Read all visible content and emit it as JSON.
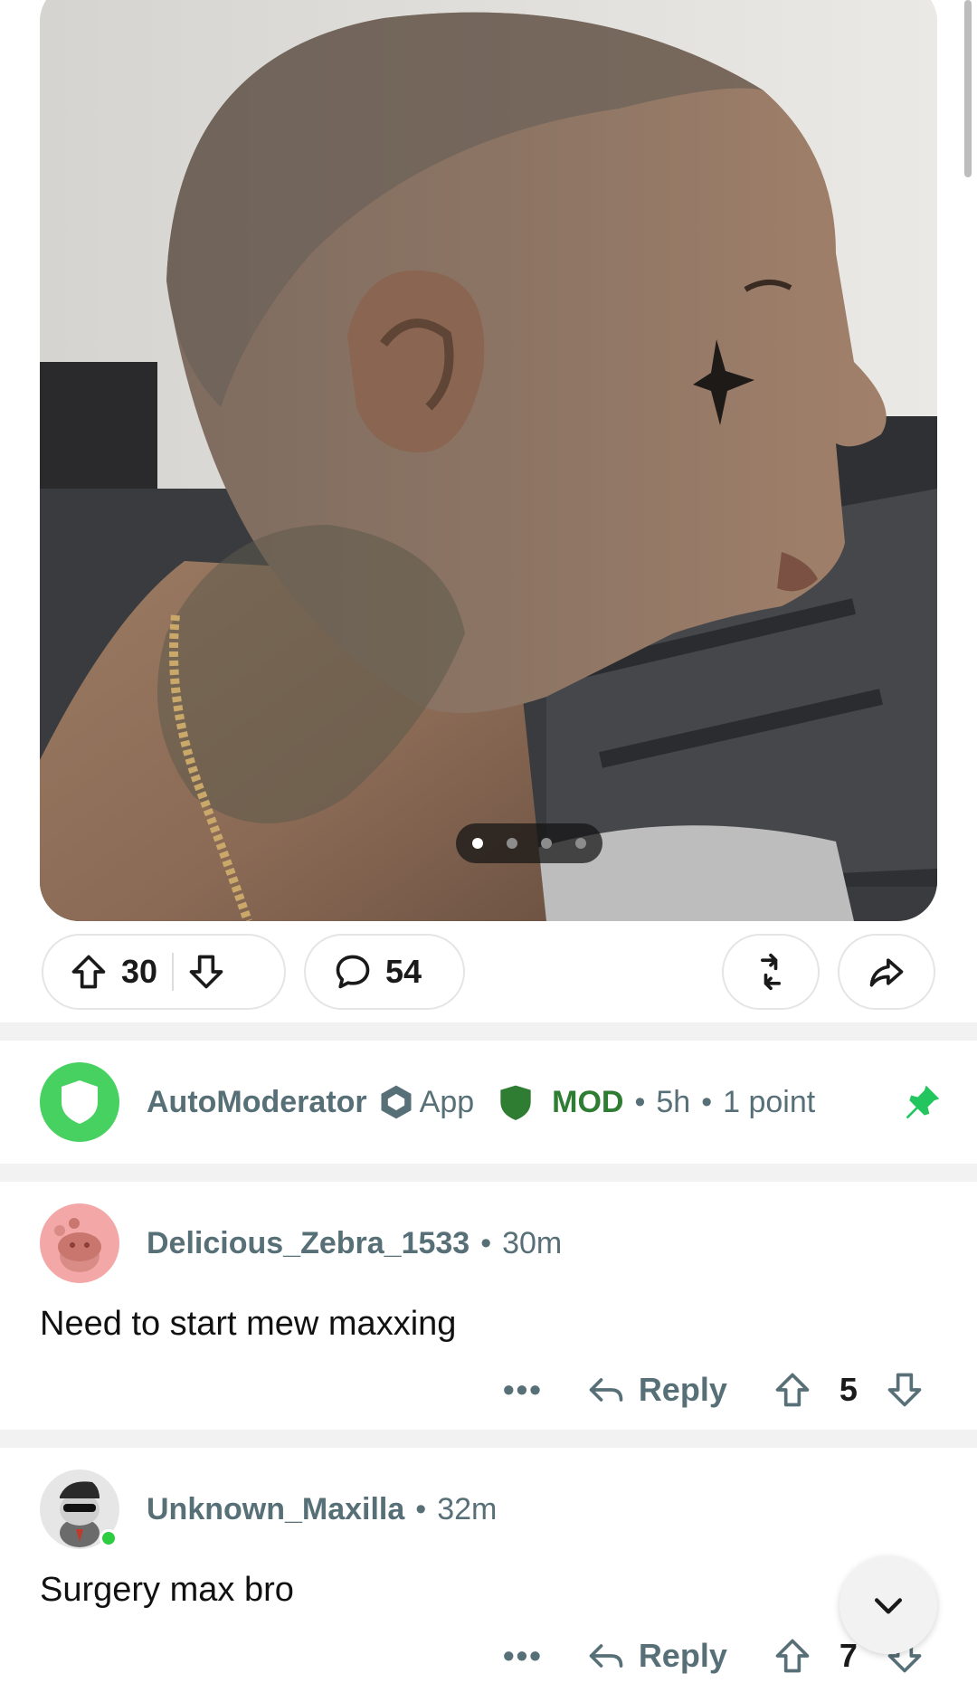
{
  "post": {
    "media": {
      "image_label": "profile photo of shaved-head man with neck tattoo",
      "pager": {
        "count": 4,
        "active": 0
      }
    },
    "actions": {
      "upvote_count": "30",
      "comment_count": "54"
    }
  },
  "comments": [
    {
      "username": "AutoModerator",
      "app_label": "App",
      "mod_label": "MOD",
      "time": "5h",
      "points": "1 point",
      "pinned": true
    },
    {
      "username": "Delicious_Zebra_1533",
      "time": "30m",
      "body": "Need to start mew maxxing",
      "reply_label": "Reply",
      "score": "5"
    },
    {
      "username": "Unknown_Maxilla",
      "time": "32m",
      "body": "Surgery max bro",
      "reply_label": "Reply",
      "score": "7"
    }
  ],
  "colors": {
    "mod_green": "#2e7d32",
    "automod_avatar": "#46d160",
    "pin_green": "#22c55e",
    "meta_gray": "#576f76",
    "online": "#2ecc40"
  }
}
